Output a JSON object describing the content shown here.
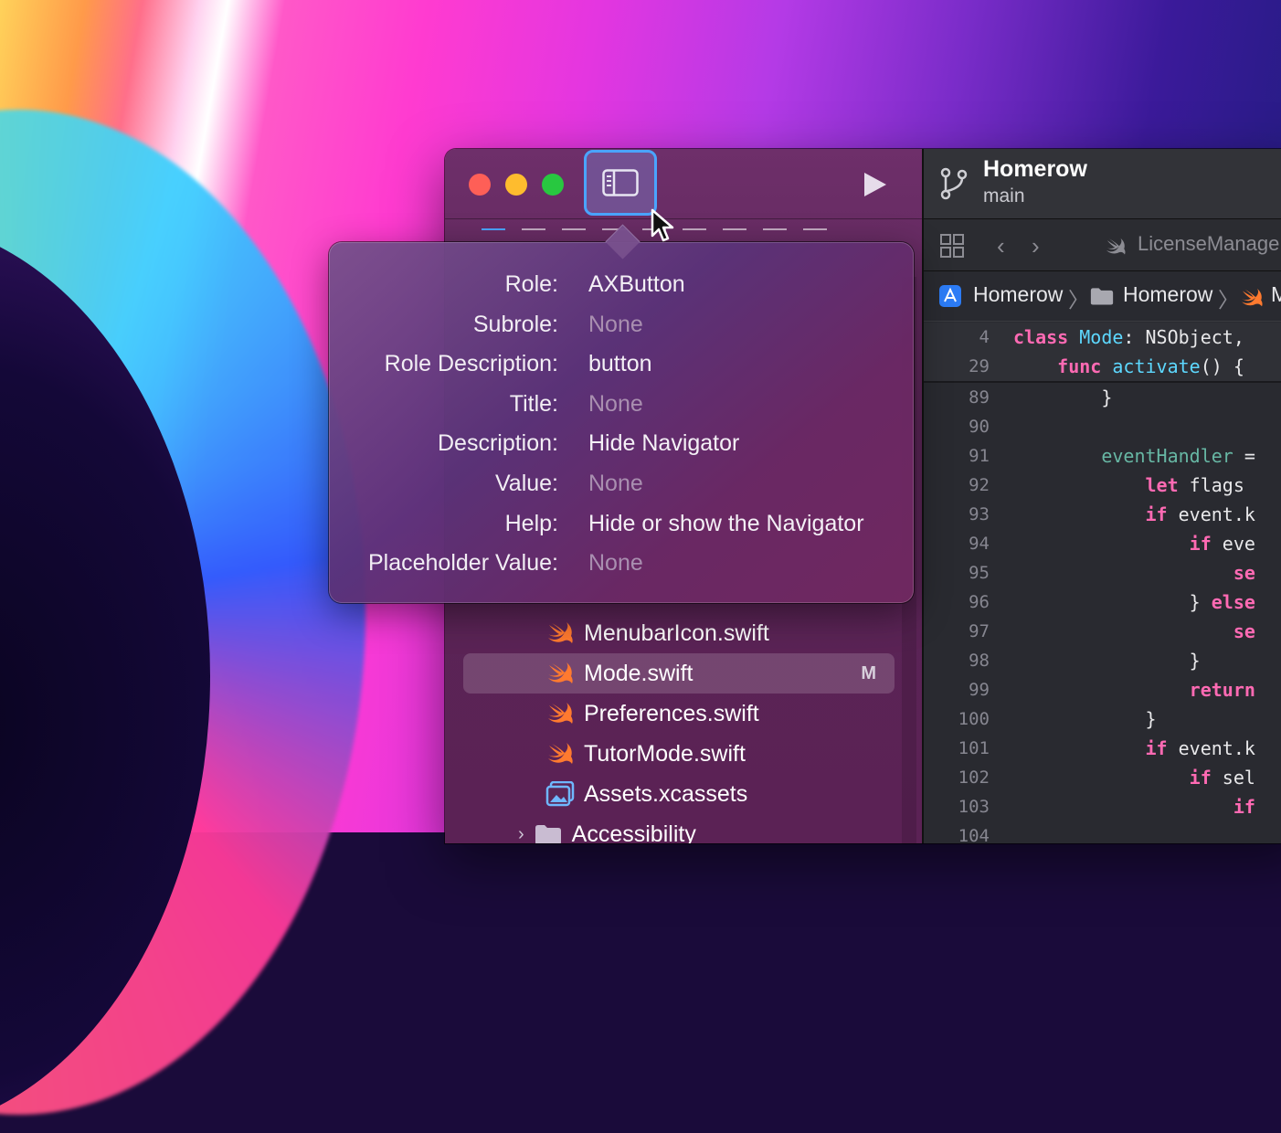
{
  "window": {
    "project_name": "Homerow",
    "branch": "main"
  },
  "toolbar": {
    "nav_toggle_icon": "sidebar-left-icon",
    "run_icon": "play-icon"
  },
  "inspector": {
    "rows": [
      {
        "label": "Role:",
        "value": "AXButton",
        "none": false
      },
      {
        "label": "Subrole:",
        "value": "None",
        "none": true
      },
      {
        "label": "Role Description:",
        "value": "button",
        "none": false
      },
      {
        "label": "Title:",
        "value": "None",
        "none": true
      },
      {
        "label": "Description:",
        "value": "Hide Navigator",
        "none": false
      },
      {
        "label": "Value:",
        "value": "None",
        "none": true
      },
      {
        "label": "Help:",
        "value": "Hide or show the Navigator",
        "none": false
      },
      {
        "label": "Placeholder Value:",
        "value": "None",
        "none": true
      }
    ]
  },
  "navigator": {
    "files": [
      {
        "name": "MenubarIcon.swift",
        "icon": "swift-icon",
        "badge": ""
      },
      {
        "name": "Mode.swift",
        "icon": "swift-icon",
        "badge": "M"
      },
      {
        "name": "Preferences.swift",
        "icon": "swift-icon",
        "badge": ""
      },
      {
        "name": "TutorMode.swift",
        "icon": "swift-icon",
        "badge": ""
      },
      {
        "name": "Assets.xcassets",
        "icon": "assets-icon",
        "badge": ""
      },
      {
        "name": "Accessibility",
        "icon": "folder-icon",
        "badge": ""
      }
    ]
  },
  "editor": {
    "tab_title": "LicenseManage",
    "jump_bar": [
      "Homerow",
      "Homerow",
      "M"
    ],
    "lines": [
      {
        "n": "4",
        "parts": [
          [
            "kw",
            "class "
          ],
          [
            "ty",
            "Mode"
          ],
          [
            "id",
            ": NSObject,"
          ]
        ]
      },
      {
        "n": "29",
        "parts": [
          [
            "id",
            "    "
          ],
          [
            "kw",
            "func "
          ],
          [
            "ty",
            "activate"
          ],
          [
            "id",
            "() {"
          ]
        ]
      },
      {
        "n": "89",
        "parts": [
          [
            "id",
            "        }"
          ]
        ]
      },
      {
        "n": "90",
        "parts": [
          [
            "id",
            ""
          ]
        ]
      },
      {
        "n": "91",
        "parts": [
          [
            "id",
            "        "
          ],
          [
            "fn",
            "eventHandler"
          ],
          [
            "id",
            " ="
          ]
        ]
      },
      {
        "n": "92",
        "parts": [
          [
            "id",
            "            "
          ],
          [
            "kw",
            "let "
          ],
          [
            "id",
            "flags"
          ]
        ]
      },
      {
        "n": "93",
        "parts": [
          [
            "id",
            "            "
          ],
          [
            "kw",
            "if "
          ],
          [
            "id",
            "event.k"
          ]
        ]
      },
      {
        "n": "94",
        "parts": [
          [
            "id",
            "                "
          ],
          [
            "kw",
            "if "
          ],
          [
            "id",
            "eve"
          ]
        ]
      },
      {
        "n": "95",
        "parts": [
          [
            "id",
            "                    "
          ],
          [
            "kw",
            "se"
          ]
        ]
      },
      {
        "n": "96",
        "parts": [
          [
            "id",
            "                } "
          ],
          [
            "kw",
            "else"
          ]
        ]
      },
      {
        "n": "97",
        "parts": [
          [
            "id",
            "                    "
          ],
          [
            "kw",
            "se"
          ]
        ]
      },
      {
        "n": "98",
        "parts": [
          [
            "id",
            "                }"
          ]
        ]
      },
      {
        "n": "99",
        "parts": [
          [
            "id",
            "                "
          ],
          [
            "kw",
            "return"
          ]
        ]
      },
      {
        "n": "100",
        "parts": [
          [
            "id",
            "            }"
          ]
        ]
      },
      {
        "n": "101",
        "parts": [
          [
            "id",
            "            "
          ],
          [
            "kw",
            "if "
          ],
          [
            "id",
            "event.k"
          ]
        ]
      },
      {
        "n": "102",
        "parts": [
          [
            "id",
            "                "
          ],
          [
            "kw",
            "if "
          ],
          [
            "id",
            "sel"
          ]
        ]
      },
      {
        "n": "103",
        "parts": [
          [
            "id",
            "                    "
          ],
          [
            "kw",
            "if"
          ]
        ]
      },
      {
        "n": "104",
        "parts": [
          [
            "id",
            ""
          ]
        ]
      }
    ]
  }
}
